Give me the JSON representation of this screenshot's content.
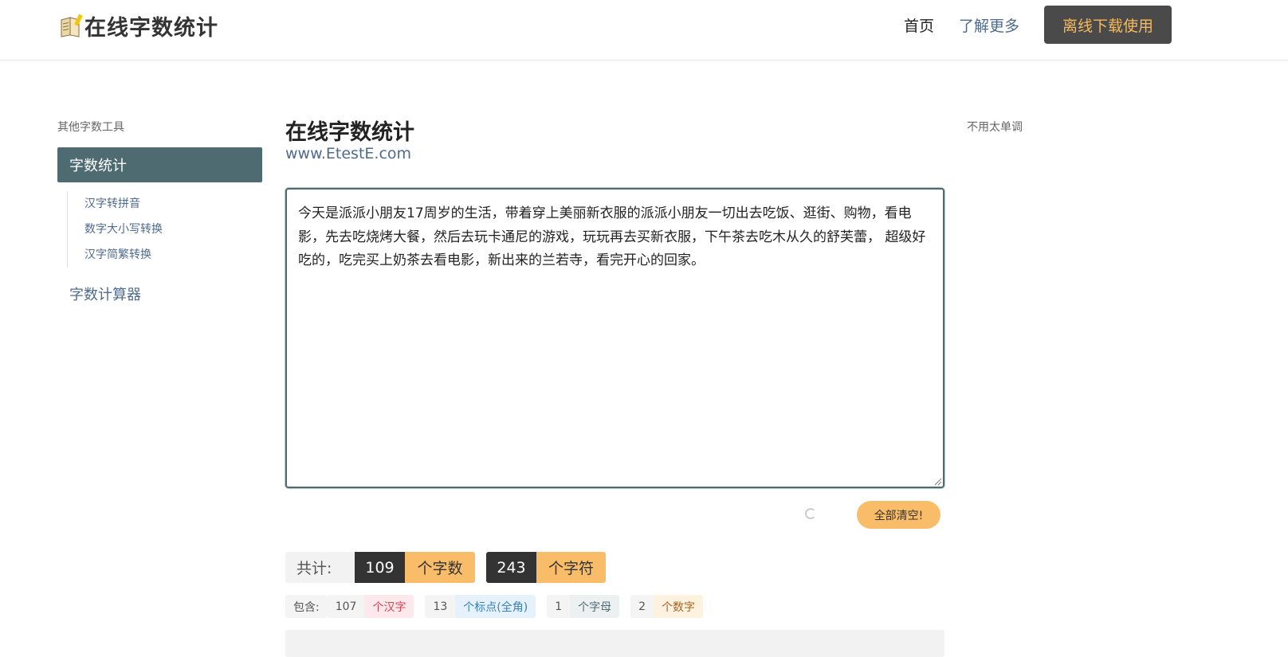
{
  "header": {
    "logo_text": "在线字数统计",
    "nav_home": "首页",
    "nav_more": "了解更多",
    "download_label": "离线下载使用"
  },
  "sidebar": {
    "title": "其他字数工具",
    "active_item": "字数统计",
    "sub_items": [
      "汉字转拼音",
      "数字大小写转换",
      "汉字简繁转换"
    ],
    "other_item": "字数计算器"
  },
  "main": {
    "title": "在线字数统计",
    "url": "www.EtestE.com",
    "editor_text": "今天是派派小朋友17周岁的生活，带着穿上美丽新衣服的派派小朋友一切出去吃饭、逛街、购物，看电影，先去吃烧烤大餐，然后去玩卡通尼的游戏，玩玩再去买新衣服，下午茶去吃木从久的舒芙蕾， 超级好吃的，吃完买上奶茶去看电影，新出来的兰若寺，看完开心的回家。",
    "clear_label": "全部清空!"
  },
  "stats": {
    "total_label": "共计:",
    "word_count": "109",
    "word_unit": "个字数",
    "char_count": "243",
    "char_unit": "个字符",
    "contain_label": "包含:",
    "items": [
      {
        "count": "107",
        "unit": "个汉字",
        "bg": "#fde8ec",
        "fg": "#d9434f"
      },
      {
        "count": "13",
        "unit": "个标点(全角)",
        "bg": "#e5f2fb",
        "fg": "#3b7fb6"
      },
      {
        "count": "1",
        "unit": "个字母",
        "bg": "#edf0f1",
        "fg": "#4e6b72"
      },
      {
        "count": "2",
        "unit": "个数字",
        "bg": "#fdf1e0",
        "fg": "#a8631f"
      }
    ]
  },
  "right": {
    "note": "不用太单调"
  },
  "colors": {
    "accent_dark": "#4e6b72",
    "accent_orange": "#f9bd69",
    "link": "#4f6b8c"
  }
}
